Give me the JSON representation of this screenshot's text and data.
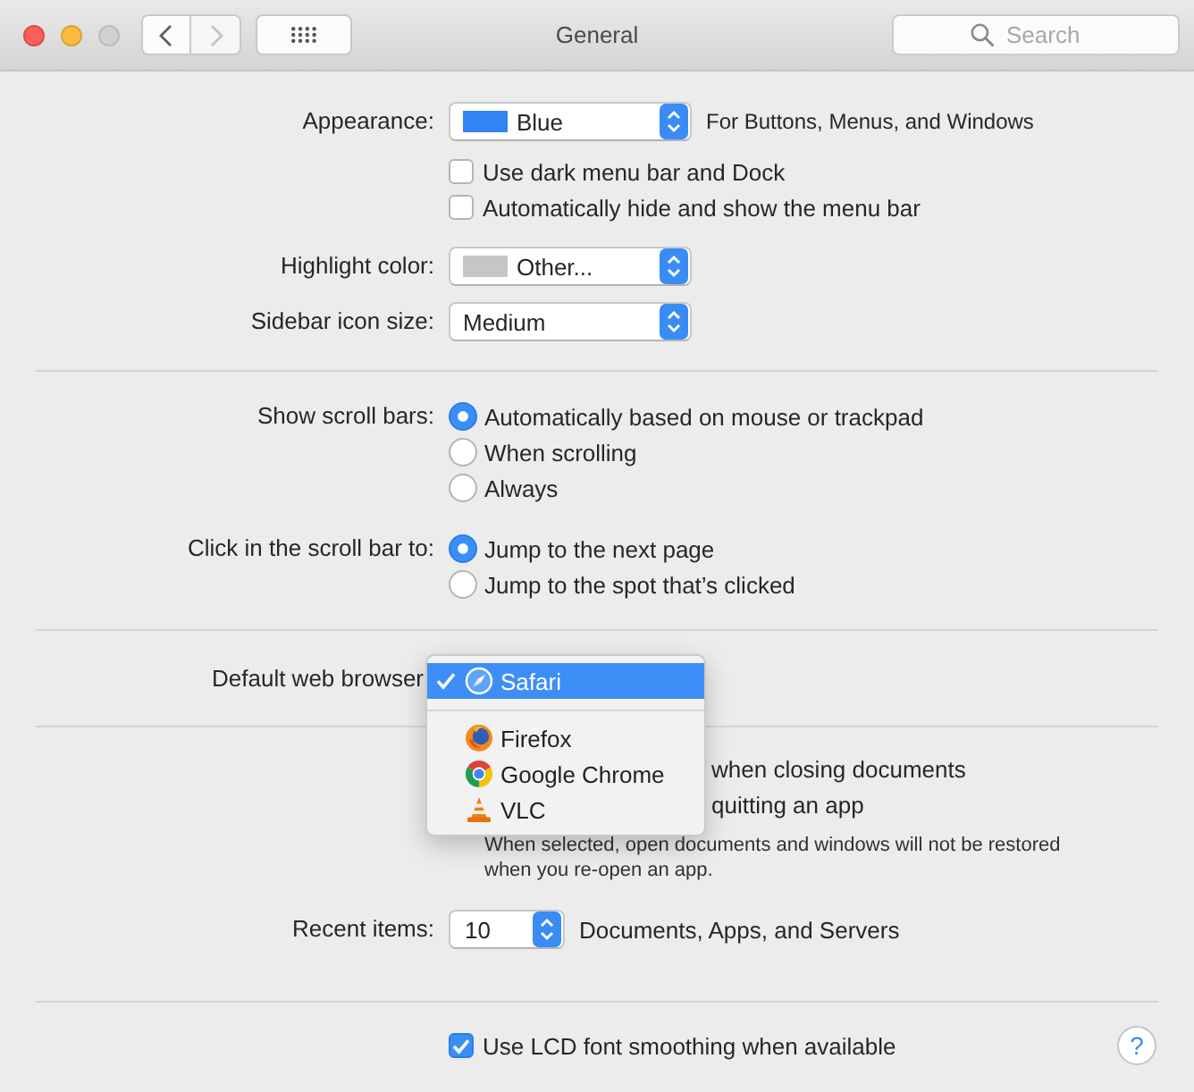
{
  "window": {
    "title": "General",
    "zoom_button": {
      "disabled": true
    },
    "back_button": {
      "disabled": false
    },
    "forward_button": {
      "disabled": true
    },
    "search": {
      "placeholder": "Search"
    }
  },
  "sections": [
    {
      "rows": [
        {
          "kind": "popup",
          "label": "Appearance:",
          "value": "Blue",
          "color": "#3284f4",
          "note": "For Buttons, Menus, and Windows"
        },
        {
          "kind": "checkbox",
          "text": "Use dark menu bar and Dock",
          "checked": false
        },
        {
          "kind": "checkbox",
          "text": "Automatically hide and show the menu bar",
          "checked": false
        },
        {
          "kind": "popup",
          "label": "Highlight color:",
          "value": "Other...",
          "color": "#c6c6c6"
        },
        {
          "kind": "popup",
          "label": "Sidebar icon size:",
          "value": "Medium"
        }
      ]
    },
    {
      "rows": [
        {
          "kind": "radio",
          "label": "Show scroll bars:",
          "options": [
            {
              "text": "Automatically based on mouse or trackpad",
              "selected": true
            },
            {
              "text": "When scrolling",
              "selected": false
            },
            {
              "text": "Always",
              "selected": false
            }
          ]
        },
        {
          "kind": "radio",
          "label": "Click in the scroll bar to:",
          "options": [
            {
              "text": "Jump to the next page",
              "selected": true
            },
            {
              "text": "Jump to the spot that’s clicked",
              "selected": false
            }
          ]
        }
      ]
    },
    {
      "rows": [
        {
          "kind": "menu",
          "label": "Default web browser",
          "groups": [
            {
              "items": [
                {
                  "text": "Safari",
                  "selected": true
                }
              ]
            },
            {
              "items": [
                {
                  "text": "Firefox",
                  "selected": false
                },
                {
                  "text": "Google Chrome",
                  "selected": false
                },
                {
                  "text": "VLC",
                  "selected": false
                }
              ]
            }
          ]
        }
      ]
    },
    {
      "rows": [
        {
          "kind": "covered",
          "text": "when closing documents"
        },
        {
          "kind": "covered",
          "text": "quitting an app"
        },
        {
          "kind": "description",
          "text": "When selected, open documents and windows will not be restored when you re-open an app."
        },
        {
          "kind": "small-popup",
          "label": "Recent items:",
          "value": "10",
          "note": "Documents, Apps, and Servers"
        }
      ]
    },
    {
      "rows": [
        {
          "kind": "checkbox",
          "text": "Use LCD font smoothing when available",
          "checked": true
        }
      ],
      "help": "?"
    }
  ]
}
